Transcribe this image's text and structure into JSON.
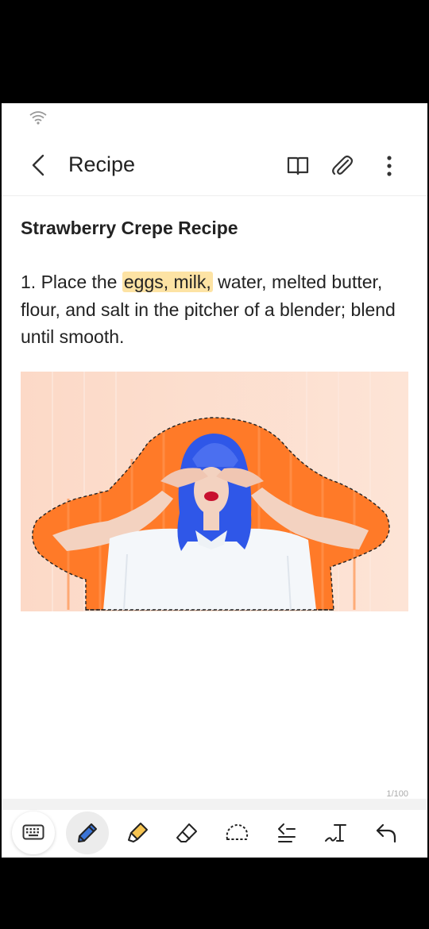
{
  "app": {
    "title": "Recipe"
  },
  "note": {
    "heading": "Strawberry Crepe Recipe",
    "step_prefix": "1. Place the ",
    "highlighted": "eggs, milk,",
    "step_suffix": " water, melted butter, flour, and salt in the pitcher of a blender; blend until smooth."
  },
  "page_indicator": "1/100",
  "icons": {
    "status": "wifi-icon",
    "back": "chevron-left-icon",
    "reading_mode": "book-icon",
    "attach": "paperclip-icon",
    "more": "more-vert-icon",
    "tools": [
      "keyboard-icon",
      "pen-icon",
      "highlighter-icon",
      "eraser-icon",
      "lasso-icon",
      "text-align-icon",
      "handwriting-to-text-icon",
      "undo-icon"
    ]
  },
  "colors": {
    "accent_pen": "#3b74d6",
    "highlight": "#fde3a4",
    "highlighter": "#f6c451",
    "photo_orange": "#ff7a28",
    "hair_blue": "#2f57e8"
  }
}
